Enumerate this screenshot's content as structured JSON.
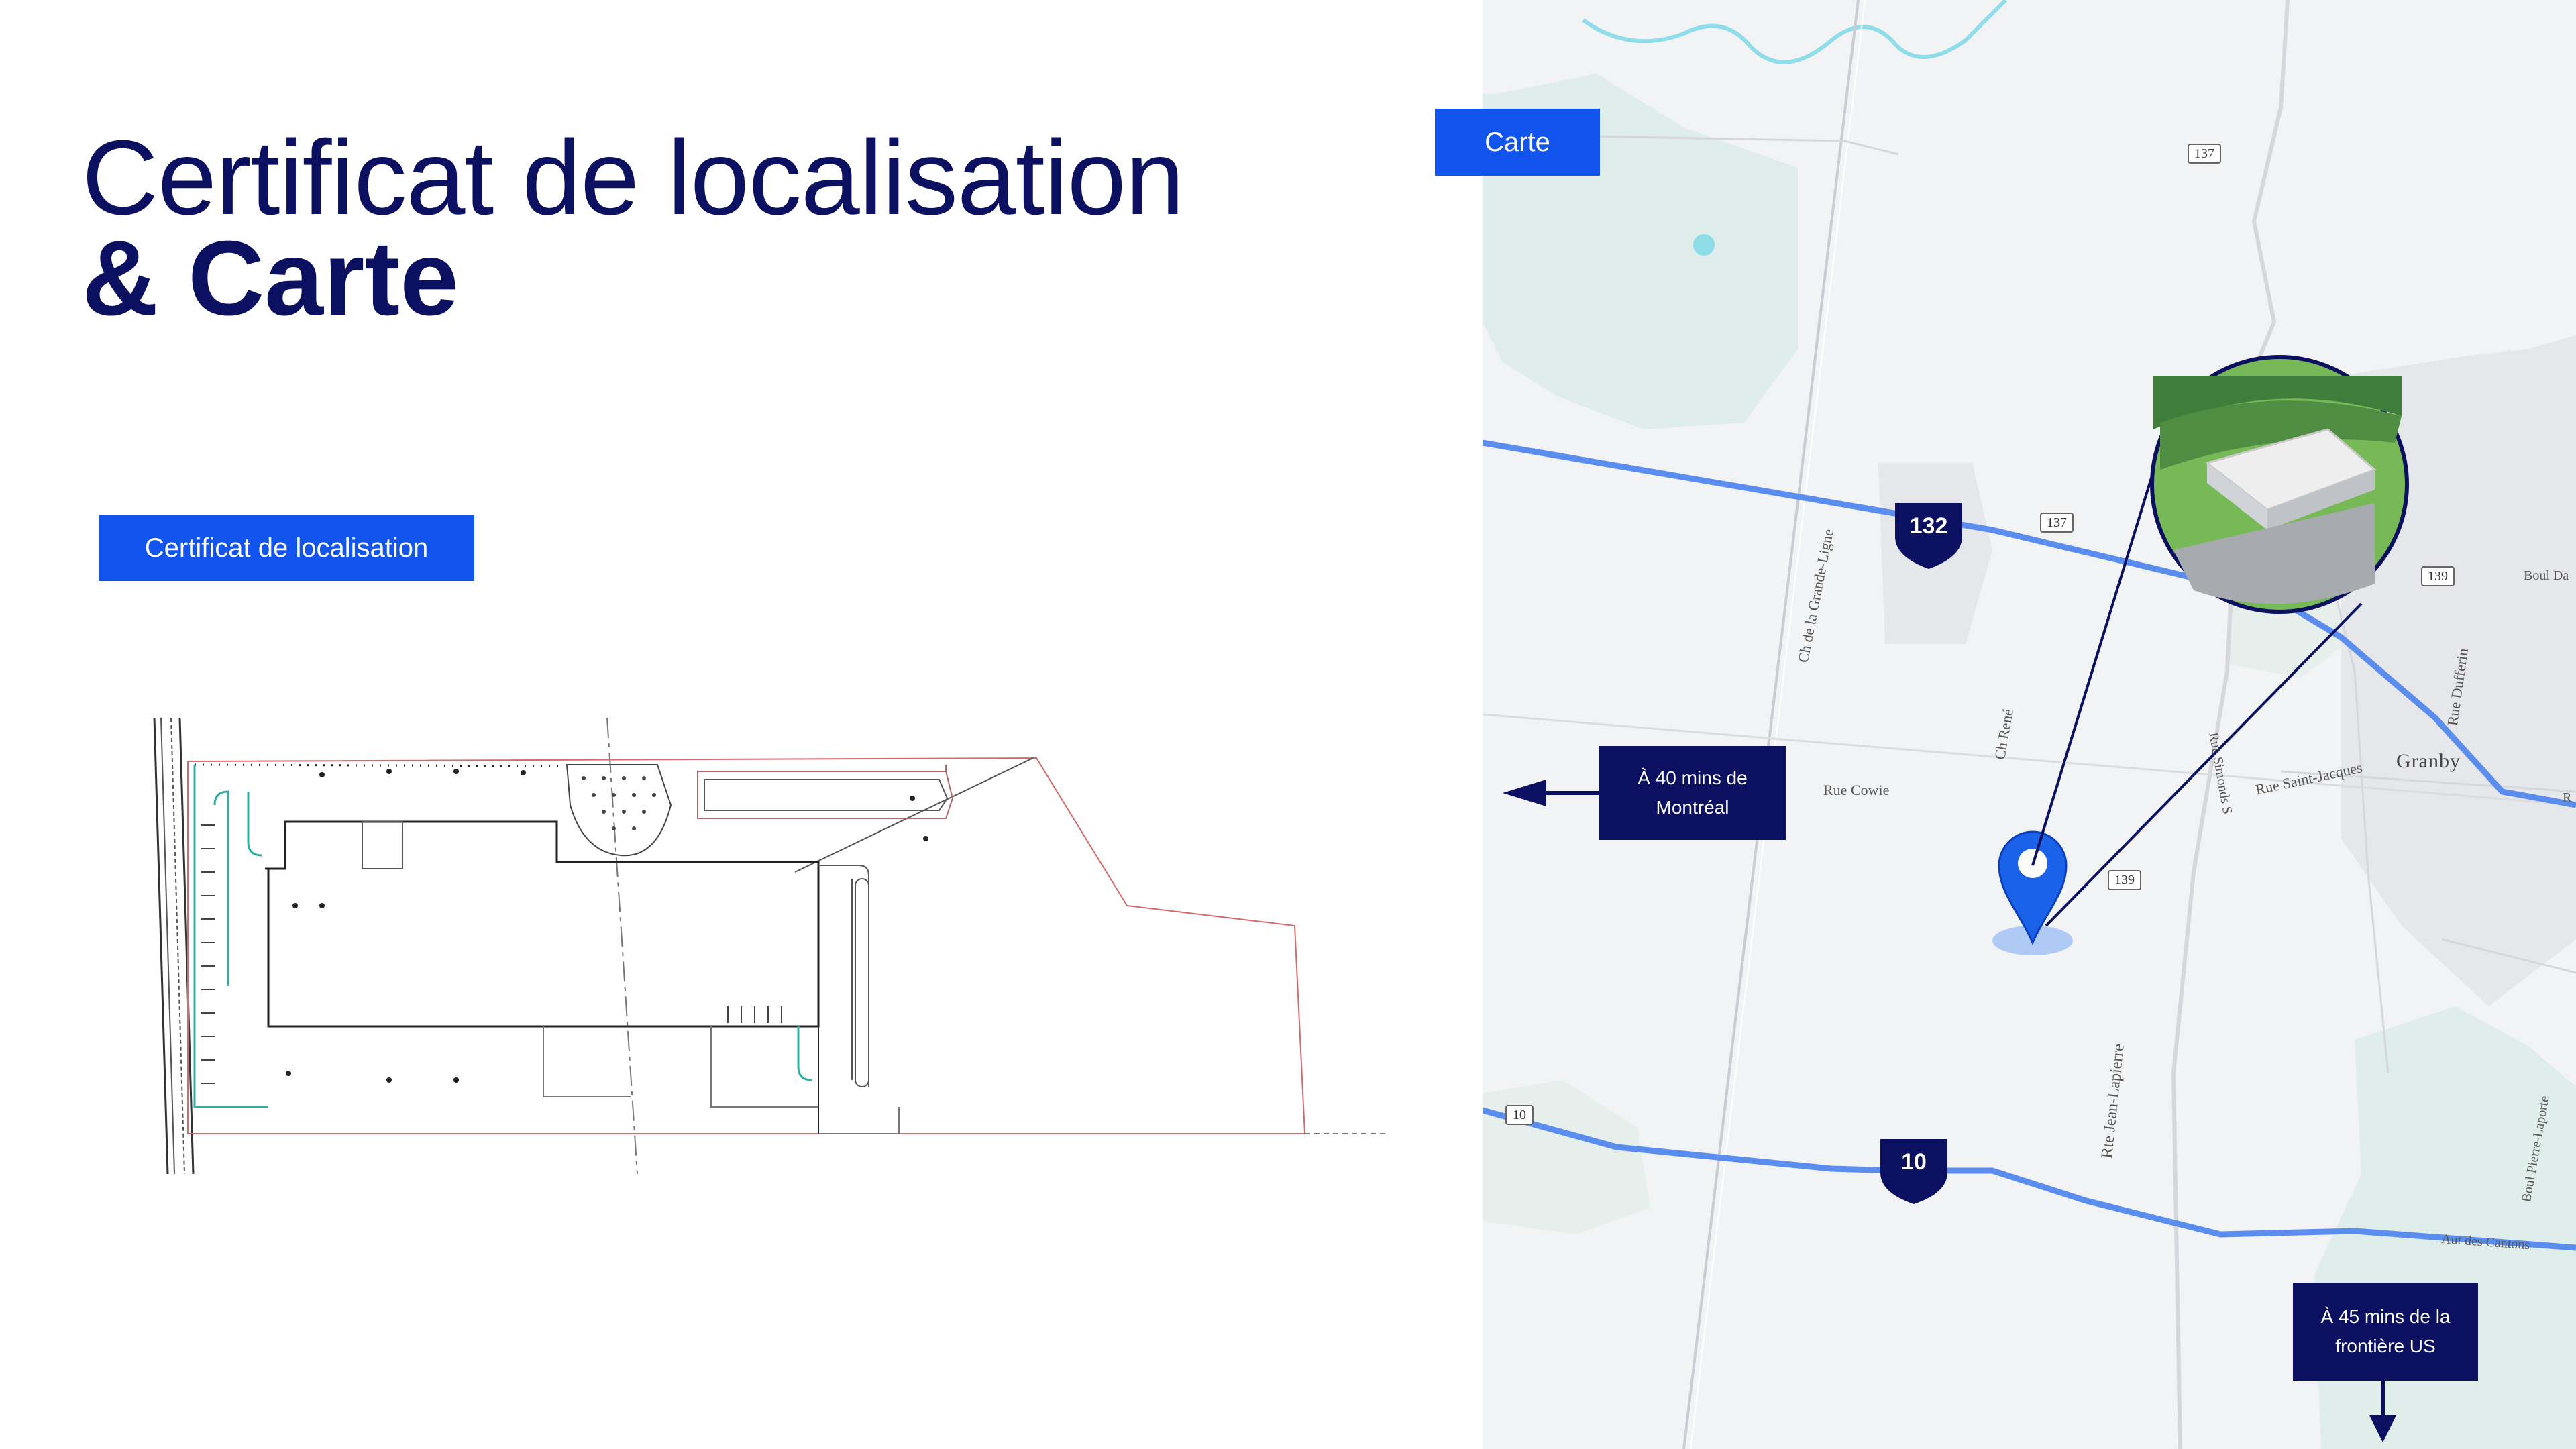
{
  "title": {
    "line1": "Certificat de localisation",
    "line2": "& Carte"
  },
  "buttons": {
    "certificate": "Certificat de localisation",
    "map": "Carte"
  },
  "callouts": {
    "montreal": {
      "line1": "À 40 mins de",
      "line2": "Montréal"
    },
    "us_border": {
      "line1": "À 45 mins  de la",
      "line2": "frontière US"
    }
  },
  "map": {
    "highway_shields": {
      "a": "132",
      "b": "10"
    },
    "route_shields": {
      "r137_top": "137",
      "r137_mid": "137",
      "r139_a": "139",
      "r139_b": "139",
      "r10_small": "10"
    },
    "streets": {
      "grande_ligne": "Ch de la Grande-Ligne",
      "rene": "Ch René",
      "cowie": "Rue Cowie",
      "saint_jacques": "Rue Saint-Jacques",
      "simonds": "Rue Simonds S",
      "dufferin": "Rue Dufferin",
      "boul_da": "Boul Da",
      "jean_lapierre": "Rte Jean-Lapierre",
      "pierre_laporte": "Boul Pierre-Laporte",
      "cantons": "Aut des Cantons",
      "r_edge": "R"
    },
    "city": "Granby"
  },
  "colors": {
    "navy": "#0b1160",
    "blue": "#1255ee",
    "highway": "#5b8def",
    "map_bg": "#f2f3f5",
    "green": "#dfeeea"
  }
}
